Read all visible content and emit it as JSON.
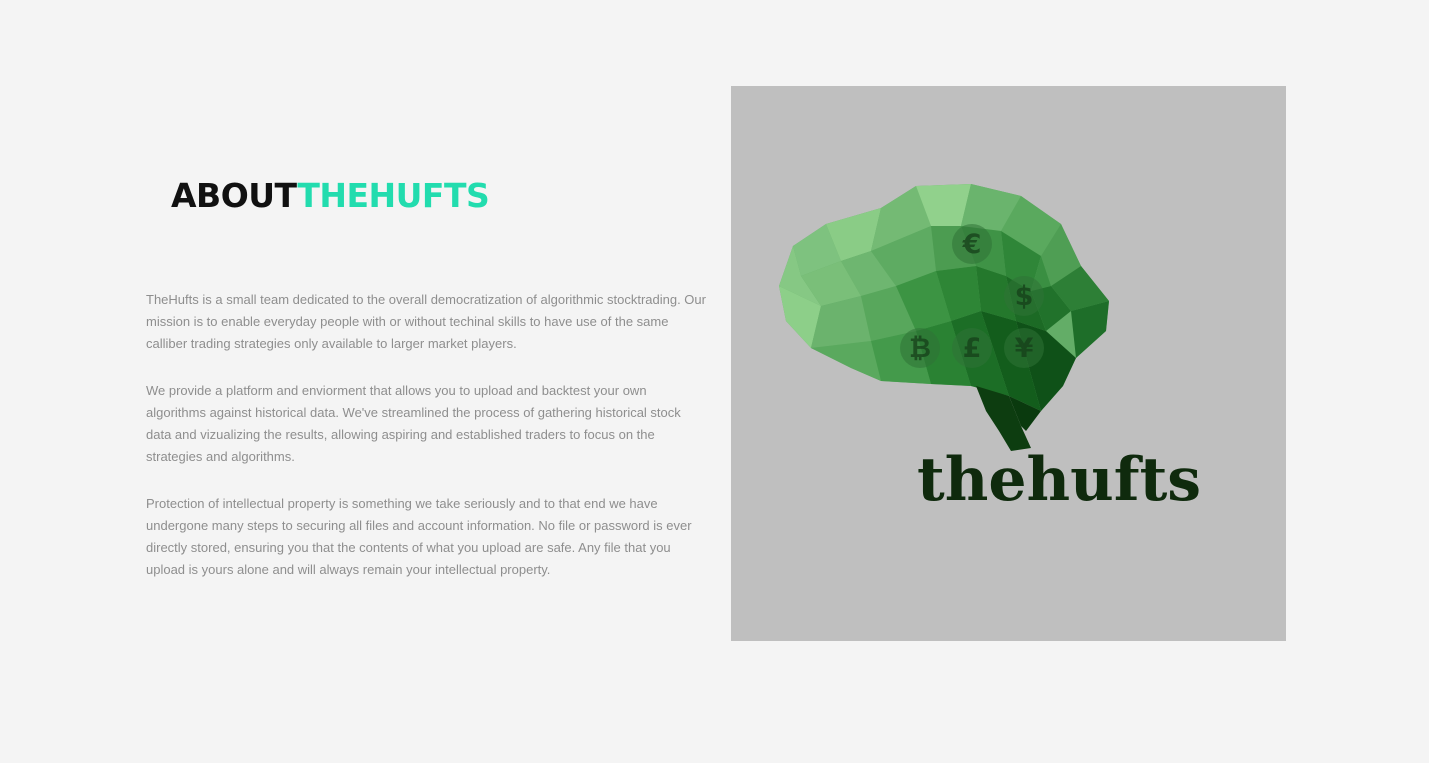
{
  "about": {
    "heading_about": "ABOUT",
    "heading_brand": "THEHUFTS",
    "paragraphs": [
      "TheHufts is a small team dedicated to the overall democratization of algorithmic stocktrading. Our mission is to enable everyday people with or without techinal skills to have use of the same calliber trading strategies only available to larger market players.",
      "We provide a platform and enviorment that allows you to upload and backtest your own algorithms against historical data. We've streamlined the process of gathering historical stock data and vizualizing the results, allowing aspiring and established traders to focus on the strategies and algorithms.",
      "Protection of intellectual property is something we take seriously and to that end we have undergone many steps to securing all files and account information. No file or password is ever directly stored, ensuring you that the contents of what you upload are safe. Any file that you upload is yours alone and will always remain your intellectual property."
    ]
  },
  "logo": {
    "wordmark": "thehufts",
    "currency_symbols": [
      "€",
      "$",
      "₿",
      "£",
      "¥"
    ],
    "image_background": "#bfbfbf"
  },
  "colors": {
    "page_background": "#f4f4f4",
    "accent": "#22dcae",
    "heading_dark": "#111111",
    "body_text": "#8e8e8e",
    "wordmark": "#0f2a0d"
  }
}
